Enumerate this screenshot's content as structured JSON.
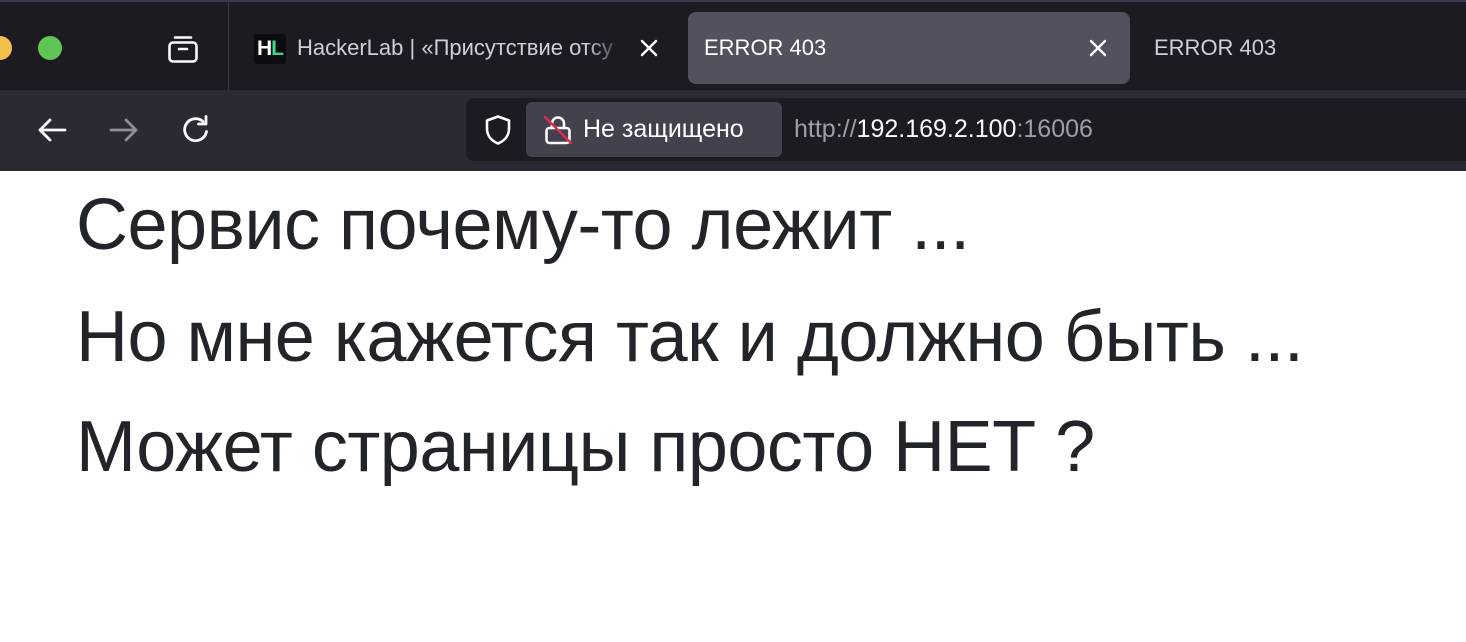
{
  "window": {
    "traffic_lights": [
      "yellow",
      "green"
    ],
    "colors": {
      "yellow": "#f5bf4f",
      "green": "#61c554"
    }
  },
  "tabs": [
    {
      "favicon": {
        "letter_1": "H",
        "letter_2": "L"
      },
      "title": "HackerLab | «Присутствие отсу",
      "active": false,
      "close_icon": "close-icon"
    },
    {
      "title": "ERROR 403",
      "active": true,
      "close_icon": "close-icon"
    },
    {
      "title": "ERROR 403",
      "active": false
    }
  ],
  "toolbar": {
    "icons": [
      "tab-overview-icon",
      "back-arrow-icon",
      "forward-arrow-icon",
      "reload-icon"
    ]
  },
  "urlbar": {
    "security_icon": "shield-icon",
    "lock_icon": "insecure-lock-icon",
    "security_label": "Не защищено",
    "url_scheme": "http://",
    "url_host": "192.169.2.100",
    "url_port": ":16006"
  },
  "page": {
    "lines": [
      "Сервис почему-то лежит ...",
      "Но мне кажется так и должно быть ...",
      "Может страницы просто НЕТ ?"
    ]
  }
}
